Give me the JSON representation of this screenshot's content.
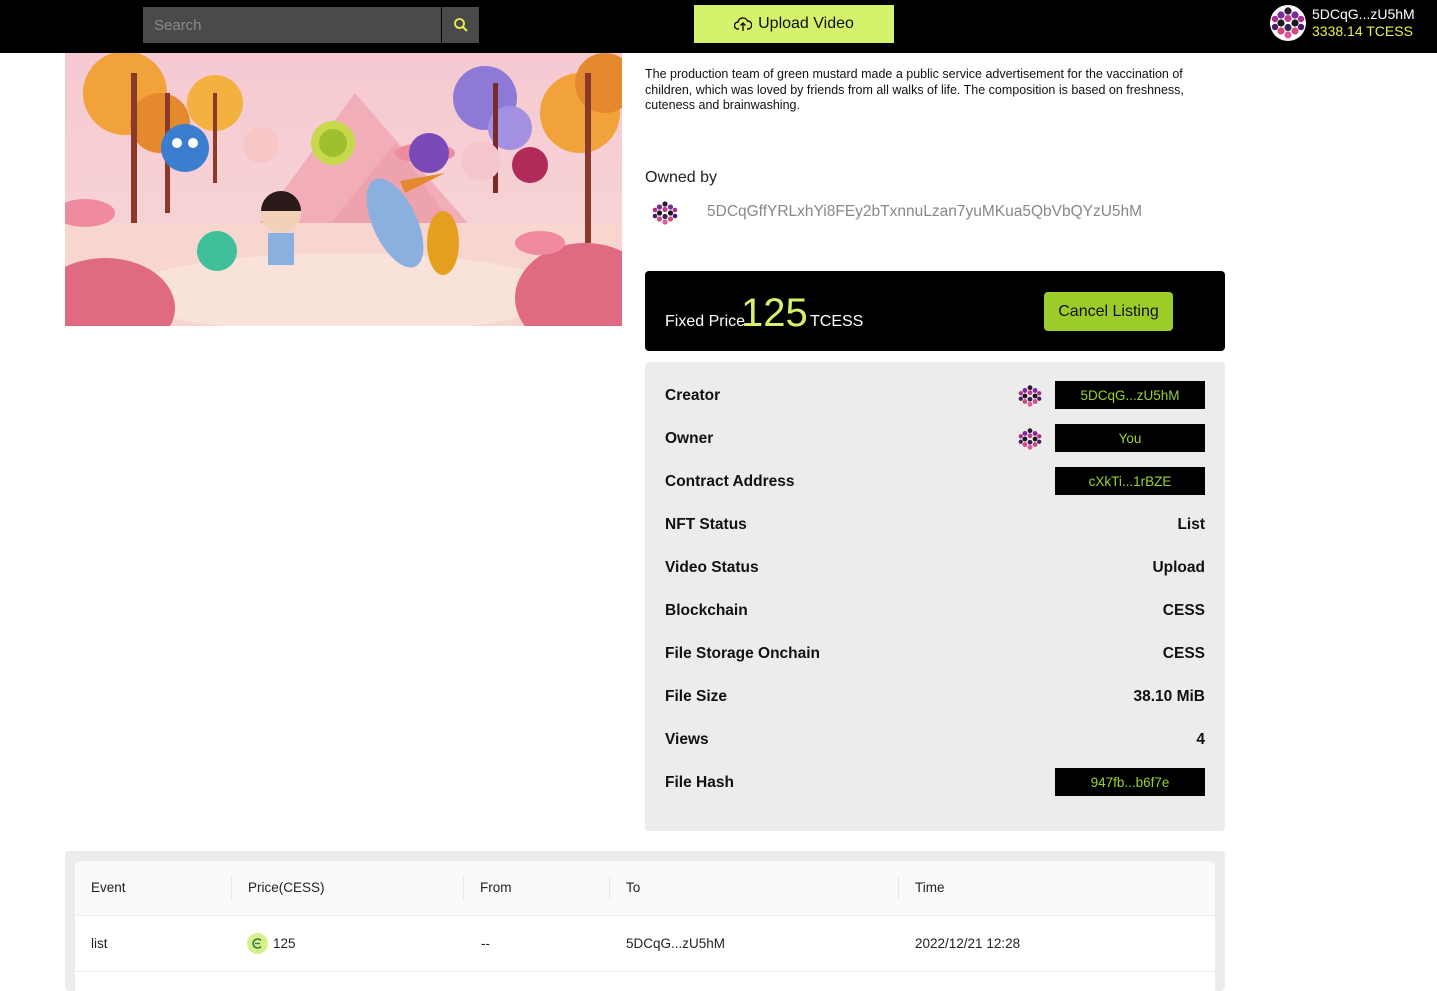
{
  "header": {
    "search_placeholder": "Search",
    "upload_label": "Upload Video",
    "account_address": "5DCqG...zU5hM",
    "account_balance": "3338.14 TCESS"
  },
  "video": {
    "description": "The production team of green mustard made a public service advertisement for the vaccination of children, which was loved by friends from all walks of life. The composition is based on freshness, cuteness and brainwashing."
  },
  "ownership": {
    "label": "Owned by",
    "address": "5DCqGffYRLxhYi8FEy2bTxnnuLzan7yuMKua5QbVbQYzU5hM"
  },
  "listing": {
    "price_label": "Fixed Price",
    "price_value": "125",
    "price_unit": "TCESS",
    "cancel_label": "Cancel Listing"
  },
  "details": {
    "creator_label": "Creator",
    "creator_value": "5DCqG...zU5hM",
    "owner_label": "Owner",
    "owner_value": "You",
    "contract_label": "Contract Address",
    "contract_value": "cXkTi...1rBZE",
    "nft_status_label": "NFT Status",
    "nft_status_value": "List",
    "video_status_label": "Video Status",
    "video_status_value": "Upload",
    "blockchain_label": "Blockchain",
    "blockchain_value": "CESS",
    "storage_label": "File Storage Onchain",
    "storage_value": "CESS",
    "size_label": "File Size",
    "size_value": "38.10 MiB",
    "views_label": "Views",
    "views_value": "4",
    "hash_label": "File Hash",
    "hash_value": "947fb...b6f7e"
  },
  "events": {
    "columns": [
      "Event",
      "Price(CESS)",
      "From",
      "To",
      "Time"
    ],
    "rows": [
      {
        "event": "list",
        "price": "125",
        "from": "--",
        "to": "5DCqG...zU5hM",
        "time": "2022/12/21 12:28"
      }
    ]
  },
  "colors": {
    "accent": "#d4f26b",
    "button_green": "#9ccc2a",
    "chip_text": "#9ad22b",
    "balance_yellow": "#e8f04a"
  },
  "icons": {
    "search": "search-icon",
    "upload": "cloud-upload-icon",
    "avatar": "polkadot-identicon",
    "coin": "cess-coin-icon"
  }
}
